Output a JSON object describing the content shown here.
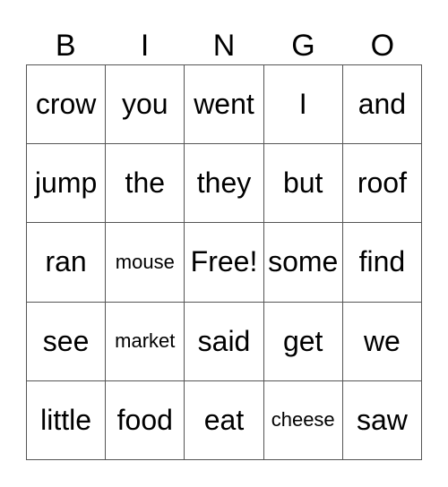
{
  "header": [
    "B",
    "I",
    "N",
    "G",
    "O"
  ],
  "rows": [
    [
      {
        "text": "crow"
      },
      {
        "text": "you"
      },
      {
        "text": "went"
      },
      {
        "text": "I"
      },
      {
        "text": "and"
      }
    ],
    [
      {
        "text": "jump"
      },
      {
        "text": "the"
      },
      {
        "text": "they"
      },
      {
        "text": "but"
      },
      {
        "text": "roof"
      }
    ],
    [
      {
        "text": "ran"
      },
      {
        "text": "mouse",
        "small": true
      },
      {
        "text": "Free!"
      },
      {
        "text": "some"
      },
      {
        "text": "find"
      }
    ],
    [
      {
        "text": "see"
      },
      {
        "text": "market",
        "small": true
      },
      {
        "text": "said"
      },
      {
        "text": "get"
      },
      {
        "text": "we"
      }
    ],
    [
      {
        "text": "little"
      },
      {
        "text": "food"
      },
      {
        "text": "eat"
      },
      {
        "text": "cheese",
        "small": true
      },
      {
        "text": "saw"
      }
    ]
  ]
}
